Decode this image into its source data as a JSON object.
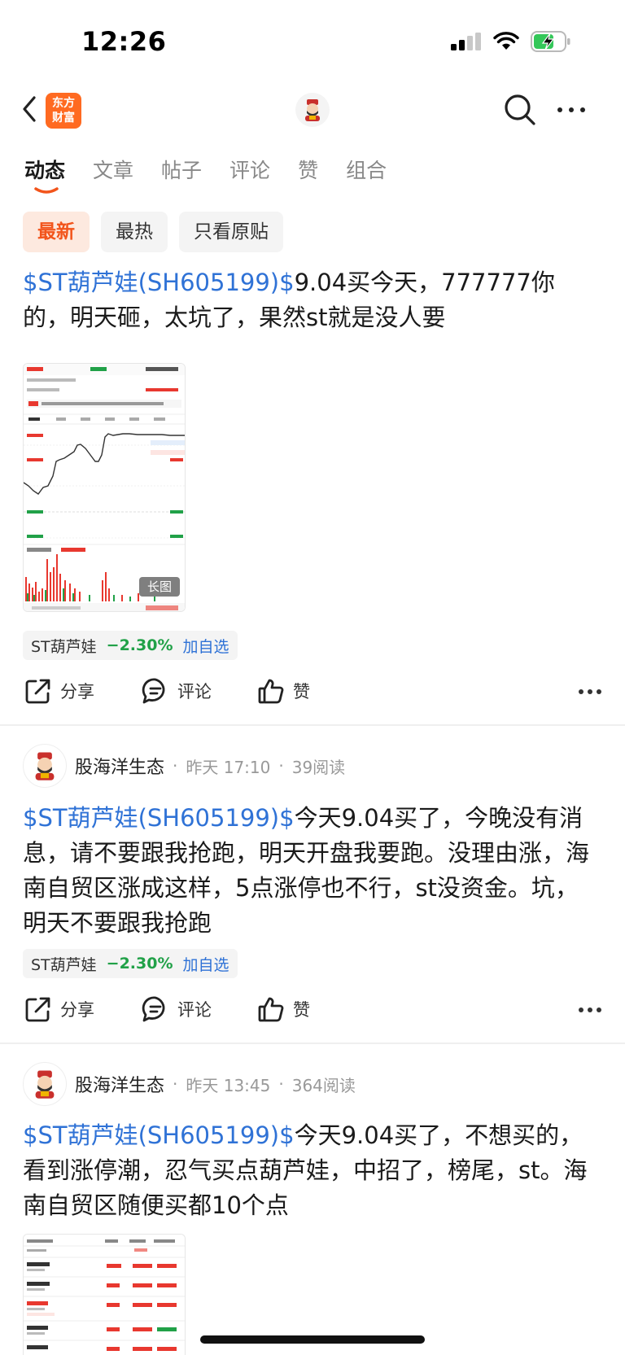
{
  "status": {
    "time": "12:26"
  },
  "header": {
    "logo_text_line1": "东方",
    "logo_text_line2": "财富"
  },
  "tabs": [
    {
      "label": "动态"
    },
    {
      "label": "文章"
    },
    {
      "label": "帖子"
    },
    {
      "label": "评论"
    },
    {
      "label": "赞"
    },
    {
      "label": "组合"
    }
  ],
  "filters": [
    {
      "label": "最新"
    },
    {
      "label": "最热"
    },
    {
      "label": "只看原贴"
    }
  ],
  "posts": [
    {
      "stock_link": "$ST葫芦娃(SH605199)$",
      "text": "9.04买今天，777777你的，明天砸，太坑了，果然st就是没人要",
      "image_badge": "长图",
      "tag": {
        "name": "ST葫芦娃",
        "change": "−2.30%",
        "add": "加自选"
      },
      "actions": {
        "share": "分享",
        "comment": "评论",
        "like": "赞"
      }
    },
    {
      "author": "股海洋生态",
      "time": "昨天 17:10",
      "reads": "39阅读",
      "stock_link": "$ST葫芦娃(SH605199)$",
      "text": "今天9.04买了，今晚没有消息，请不要跟我抢跑，明天开盘我要跑。没理由涨，海南自贸区涨成这样，5点涨停也不行，st没资金。坑，明天不要跟我抢跑",
      "tag": {
        "name": "ST葫芦娃",
        "change": "−2.30%",
        "add": "加自选"
      },
      "actions": {
        "share": "分享",
        "comment": "评论",
        "like": "赞"
      }
    },
    {
      "author": "股海洋生态",
      "time": "昨天 13:45",
      "reads": "364阅读",
      "stock_link": "$ST葫芦娃(SH605199)$",
      "text": "今天9.04买了，不想买的，看到涨停潮，忍气买点葫芦娃，中招了，榜尾，st。海南自贸区随便买都10个点"
    }
  ],
  "colors": {
    "accent": "#f2541b",
    "link": "#2f72d6",
    "down": "#21a148",
    "up": "#e8382f"
  }
}
